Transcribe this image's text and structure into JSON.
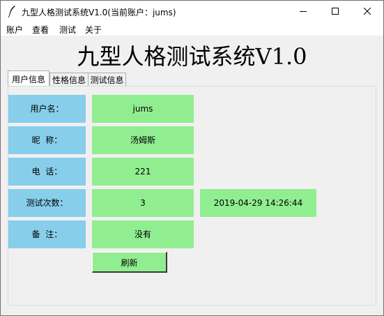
{
  "window": {
    "title": "九型人格测试系统V1.0(当前账户：jums)"
  },
  "menu": [
    "账户",
    "查看",
    "测试",
    "关于"
  ],
  "app_title": "九型人格测试系统V1.0",
  "tabs": [
    "用户信息",
    "性格信息",
    "测试信息"
  ],
  "fields": [
    {
      "label": "用户名：",
      "value": "jums"
    },
    {
      "label": "昵  称：",
      "value": "汤姆斯"
    },
    {
      "label": "电  话：",
      "value": "221"
    },
    {
      "label": "测试次数：",
      "value": "3"
    },
    {
      "label": "备  注：",
      "value": "没有"
    }
  ],
  "last_test_time": "2019-04-29 14:26:44",
  "refresh_label": "刷新",
  "colors": {
    "label_bg": "#87ceeb",
    "value_bg": "#90ee90"
  },
  "icons": {
    "app": "feather-icon",
    "minimize": "minimize-icon",
    "maximize": "maximize-icon",
    "close": "close-icon"
  }
}
